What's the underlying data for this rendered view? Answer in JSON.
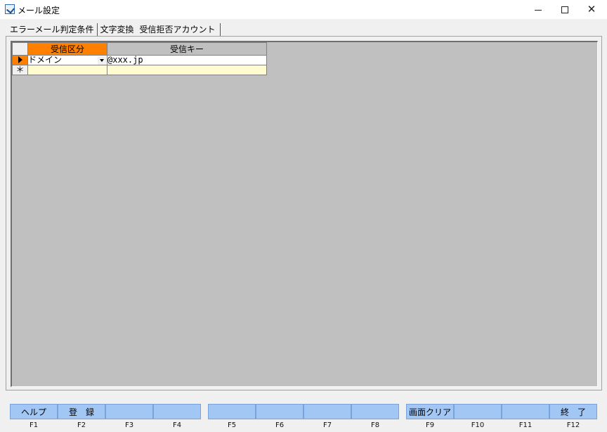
{
  "window": {
    "title": "メール設定",
    "minimize_icon": "minimize-icon",
    "maximize_icon": "maximize-icon",
    "close_icon": "close-icon"
  },
  "tabs": [
    {
      "label": "エラーメール判定条件"
    },
    {
      "label": "文字変換"
    },
    {
      "label": "受信拒否アカウント"
    }
  ],
  "active_tab": "受信拒否アカウント",
  "grid": {
    "columns": [
      "受信区分",
      "受信キー"
    ],
    "rows": [
      {
        "kubun": "ドメイン",
        "key": "@xxx.jp"
      }
    ],
    "new_row_marker": "＊"
  },
  "function_keys": [
    {
      "label": "ヘルプ",
      "key": "F1"
    },
    {
      "label": "登　録",
      "key": "F2"
    },
    {
      "label": "",
      "key": "F3"
    },
    {
      "label": "",
      "key": "F4"
    },
    {
      "label": "",
      "key": "F5"
    },
    {
      "label": "",
      "key": "F6"
    },
    {
      "label": "",
      "key": "F7"
    },
    {
      "label": "",
      "key": "F8"
    },
    {
      "label": "画面クリア",
      "key": "F9"
    },
    {
      "label": "",
      "key": "F10"
    },
    {
      "label": "",
      "key": "F11"
    },
    {
      "label": "終　了",
      "key": "F12"
    }
  ],
  "colors": {
    "accent_orange": "#ff7f00",
    "fkey_blue": "#a3c7f5",
    "grid_bg": "#c0c0c0",
    "new_row_yellow": "#fffcd0"
  }
}
